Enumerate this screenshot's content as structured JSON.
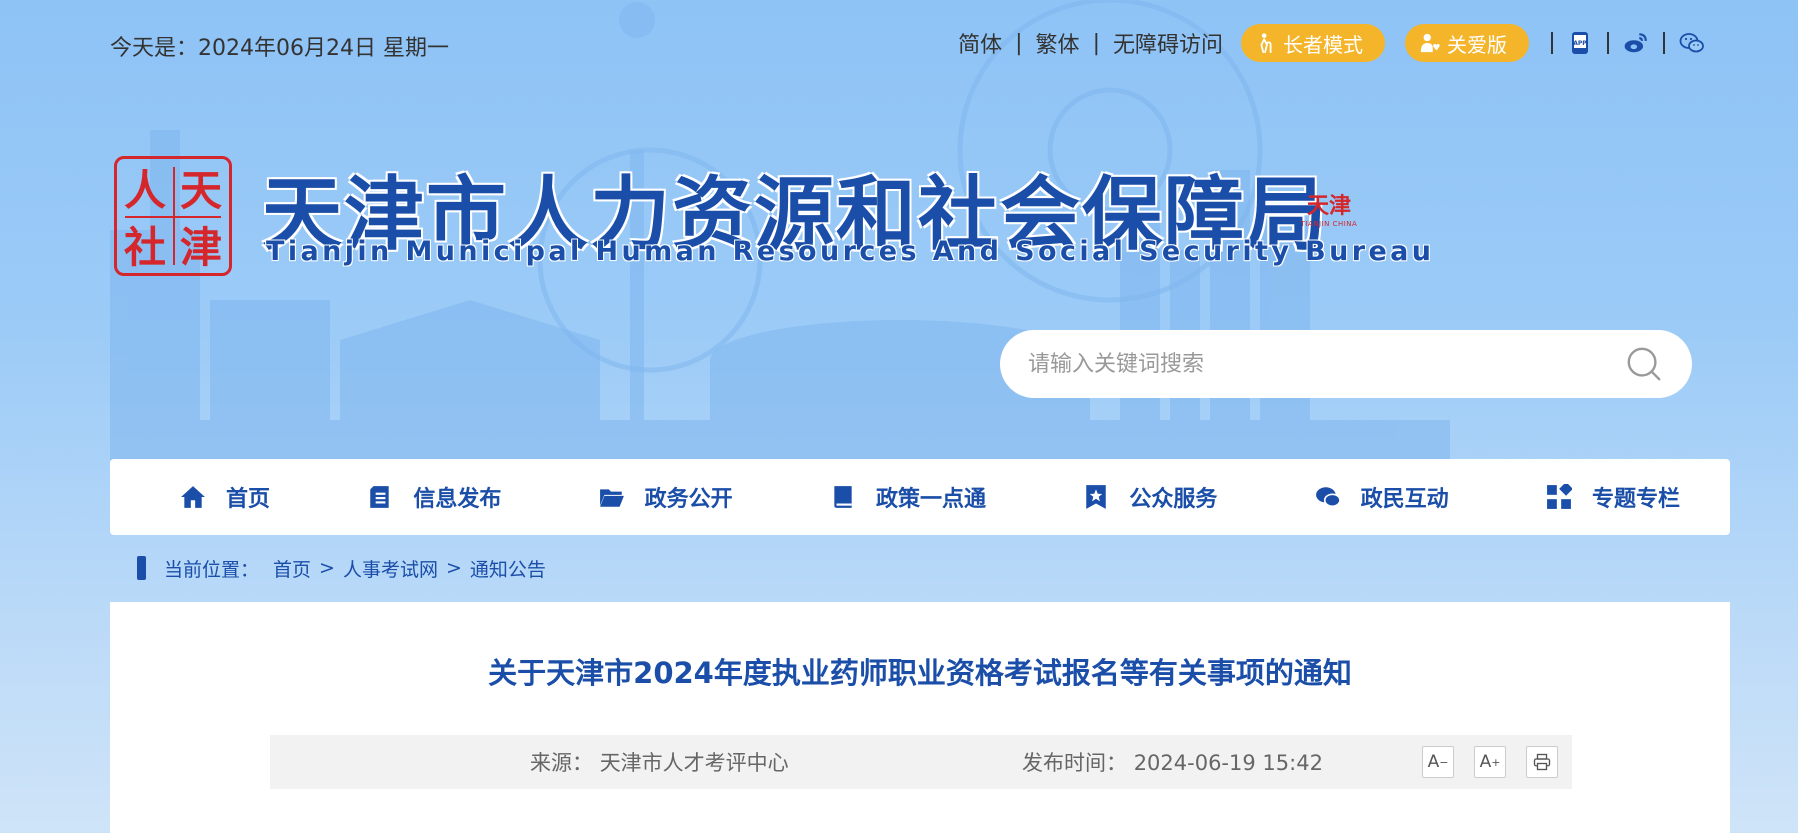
{
  "topbar": {
    "date_prefix": "今天是：",
    "date_value": "2024年06月24日 星期一",
    "lang_simplified": "简体",
    "lang_traditional": "繁体",
    "accessibility": "无障碍访问",
    "elder_mode": "长者模式",
    "care_mode": "关爱版",
    "icons": [
      "app-icon",
      "weibo-icon",
      "wechat-icon"
    ]
  },
  "header": {
    "seal_chars": [
      "人",
      "天",
      "社",
      "津"
    ],
    "title": "天津市人力资源和社会保障局",
    "subtitle": "Tianjin Municipal Human Resources And Social Security Bureau",
    "badge_text": "天津",
    "badge_sub": "TIANJIN CHINA"
  },
  "search": {
    "placeholder": "请输入关键词搜索"
  },
  "nav": [
    {
      "label": "首页",
      "icon": "home-icon"
    },
    {
      "label": "信息发布",
      "icon": "document-icon"
    },
    {
      "label": "政务公开",
      "icon": "folder-icon"
    },
    {
      "label": "政策一点通",
      "icon": "book-icon"
    },
    {
      "label": "公众服务",
      "icon": "bookmark-star-icon"
    },
    {
      "label": "政民互动",
      "icon": "chat-icon"
    },
    {
      "label": "专题专栏",
      "icon": "grid-icon"
    }
  ],
  "breadcrumb": {
    "prefix": "当前位置：",
    "items": [
      "首页",
      "人事考试网",
      "通知公告"
    ],
    "separator": ">"
  },
  "article": {
    "title": "关于天津市2024年度执业药师职业资格考试报名等有关事项的通知",
    "source_label": "来源：",
    "source_value": "天津市人才考评中心",
    "publish_label": "发布时间：",
    "publish_value": "2024-06-19 15:42",
    "font_decrease": "A",
    "font_increase": "A"
  },
  "colors": {
    "brand_blue": "#1a4ea8",
    "accent_yellow": "#f4b52b",
    "seal_red": "#d4262b"
  }
}
